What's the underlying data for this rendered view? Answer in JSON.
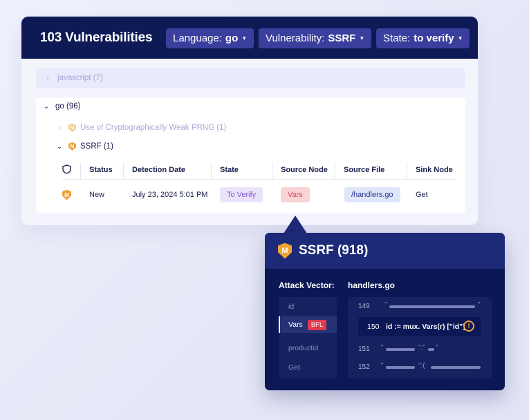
{
  "header": {
    "title": "103 Vulnerabilities",
    "filters": [
      {
        "label": "Language:",
        "value": "go"
      },
      {
        "label": "Vulnerability:",
        "value": "SSRF"
      },
      {
        "label": "State:",
        "value": "to verify"
      }
    ]
  },
  "groups": {
    "javascript": "javascript (7)",
    "go": "go (96)",
    "weak_prng": "Use of Cryptographically Weak PRNG (1)",
    "ssrf": "SSRF (1)",
    "badge_letter": "M"
  },
  "table": {
    "columns": [
      "Status",
      "Detection Date",
      "State",
      "Source Node",
      "Source File",
      "Sink Node"
    ],
    "rows": [
      {
        "severity": "M",
        "status": "New",
        "date": "July 23, 2024 5:01 PM",
        "state": "To Verify",
        "source_node": "Vars",
        "source_file": "/handlers.go",
        "sink_node": "Get"
      }
    ]
  },
  "popup": {
    "badge": "M",
    "title": "SSRF (918)",
    "attack_vector_label": "Attack Vector:",
    "file_label": "handlers.go",
    "vectors": [
      {
        "name": "id",
        "active": false
      },
      {
        "name": "Vars",
        "active": true,
        "tag": "BFL"
      },
      {
        "name": "productid",
        "active": false
      },
      {
        "name": "Get",
        "active": false
      }
    ],
    "code": {
      "line_149": "149",
      "line_150": "150",
      "line_150_code": "id := mux. Vars(r) [\"id\"]",
      "line_151": "151",
      "line_152": "152",
      "warn_symbol": "!"
    }
  },
  "colors": {
    "header_bg": "#0e1a55",
    "filter_bg": "#3a3f9e",
    "badge_orange": "#f0a234",
    "state_pill": "#7a57d1",
    "vars_pill": "#d8404f",
    "bfl_tag": "#e23a4c"
  },
  "icons": {
    "expand": "chevron-right-icon",
    "collapse": "chevron-down-icon",
    "severity": "shield-m-icon",
    "shield_header": "shield-outline-icon",
    "warning": "warning-circle-icon"
  }
}
